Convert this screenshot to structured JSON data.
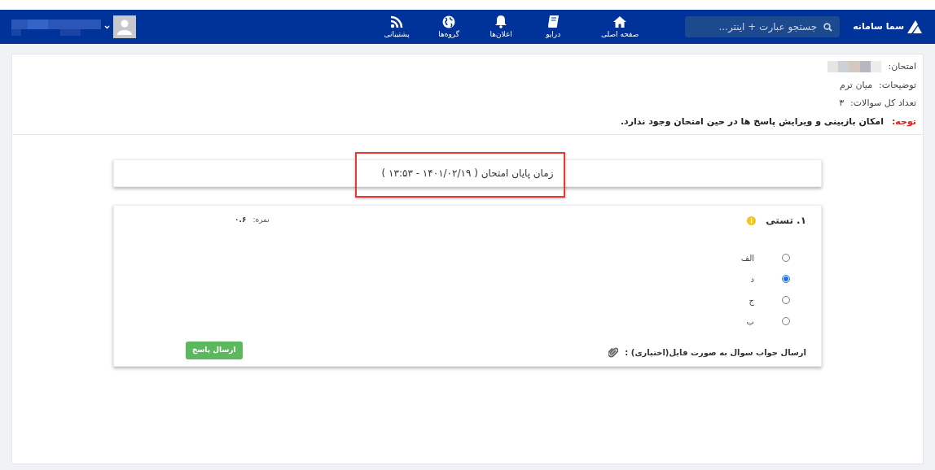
{
  "navbar": {
    "logo": "سما سامانه",
    "search": {
      "placeholder": "جستجو عبارت + اینتر..."
    },
    "items": [
      {
        "label": "صفحه اصلی",
        "kind": "home"
      },
      {
        "label": "درایو",
        "kind": "book"
      },
      {
        "label": "اعلان‌ها",
        "kind": "bell"
      },
      {
        "label": "گروه‌ها",
        "kind": "globe"
      },
      {
        "label": "پشتیبانی",
        "kind": "rss"
      }
    ]
  },
  "exam_info": [
    {
      "label": "امتحان:",
      "kind": "blurred"
    },
    {
      "label": "توضیحات:",
      "value": "میان ترم"
    },
    {
      "label": "تعداد کل سوالات:",
      "value": "۳"
    }
  ],
  "notice": {
    "label": "توجه:",
    "text": "امکان بازبینی و ویرایش پاسخ ها در حین امتحان وجود ندارد."
  },
  "timer": {
    "text": "زمان پایان امتحان ( ۱۴۰۱/۰۲/۱۹ - ۱۳:۵۳ )",
    "highlighted": true
  },
  "question": {
    "title": "۱. تستی",
    "score_label": "نمره:",
    "score": "۰.۶",
    "options": [
      {
        "label": "الف",
        "selected": false
      },
      {
        "label": "د",
        "selected": true
      },
      {
        "label": "ج",
        "selected": false
      },
      {
        "label": "ب",
        "selected": false
      }
    ],
    "file_prompt": "ارسال جواب سوال به صورت فایل(اختیاری) :",
    "submit": "ارسال پاسخ"
  }
}
